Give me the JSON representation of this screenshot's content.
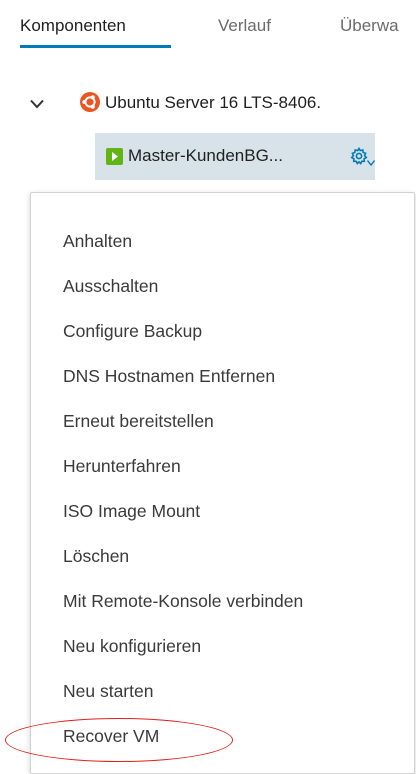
{
  "tabs": [
    {
      "label": "Komponenten",
      "active": true
    },
    {
      "label": "Verlauf",
      "active": false
    },
    {
      "label": "Überwa",
      "active": false
    }
  ],
  "tree": {
    "parent_label": "Ubuntu Server 16 LTS-8406.",
    "parent_icon": "ubuntu-icon",
    "child_label": "Master-KundenBG...",
    "child_icon": "vm-icon",
    "settings_icon": "gear-icon"
  },
  "menu": {
    "items": [
      "Anhalten",
      "Ausschalten",
      "Configure Backup",
      "DNS Hostnamen Entfernen",
      "Erneut bereitstellen",
      "Herunterfahren",
      "ISO Image Mount",
      "Löschen",
      "Mit Remote-Konsole verbinden",
      "Neu konfigurieren",
      "Neu starten",
      "Recover VM"
    ],
    "highlighted_item": "Recover VM"
  },
  "colors": {
    "accent": "#0079b8",
    "selected_row_bg": "#d8e3e9",
    "ubuntu_orange": "#e95420",
    "vm_green": "#60b515",
    "highlight_red": "#e0201c"
  }
}
